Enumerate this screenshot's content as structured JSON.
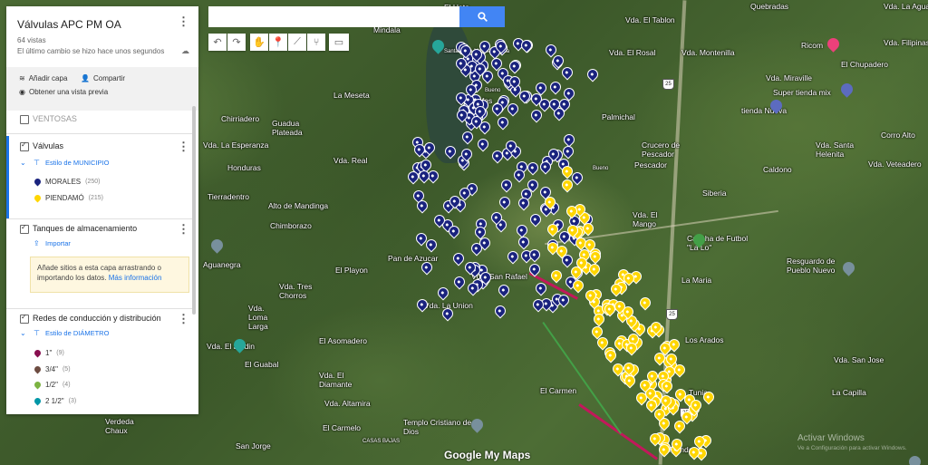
{
  "search": {
    "placeholder": "",
    "value": ""
  },
  "toolbar": {
    "undo_icon": "undo-icon",
    "redo_icon": "redo-icon",
    "hand_icon": "hand-icon",
    "marker_icon": "add-marker-icon",
    "line_icon": "draw-line-icon",
    "directions_icon": "directions-icon",
    "measure_icon": "ruler-icon"
  },
  "panel": {
    "title": "Válvulas APC PM OA",
    "views": "64 vistas",
    "last_change": "El último cambio se hizo hace unos segundos",
    "add_layer": "Añadir capa",
    "share": "Compartir",
    "preview": "Obtener una vista previa"
  },
  "layers": {
    "ventosas": {
      "name": "VENTOSAS"
    },
    "valvulas": {
      "name": "Válvulas",
      "style": "Estilo de MUNICIPIO",
      "items": [
        {
          "label": "MORALES",
          "count": "(250)",
          "color": "#1a237e"
        },
        {
          "label": "PIENDAMÓ",
          "count": "(215)",
          "color": "#ffd600"
        }
      ]
    },
    "tanques": {
      "name": "Tanques de almacenamiento",
      "import": "Importar",
      "notice": "Añade sitios a esta capa arrastrando o importando los datos.",
      "more_info": "Más información"
    },
    "redes": {
      "name": "Redes de conducción y distribución",
      "style": "Estilo de DIÁMETRO",
      "items": [
        {
          "label": "1\"",
          "count": "(9)",
          "color": "#880e4f"
        },
        {
          "label": "3/4\"",
          "count": "(5)",
          "color": "#6d4c41"
        },
        {
          "label": "1/2\"",
          "count": "(4)",
          "color": "#7cb342"
        },
        {
          "label": "2 1/2\"",
          "count": "(3)",
          "color": "#0097a7"
        }
      ]
    }
  },
  "map": {
    "places": [
      "Quebradas",
      "Vda. La Aguada",
      "El Hato",
      "Mindala",
      "Santa Rosa Morales cauca",
      "Vda. El Tablon",
      "Vda. El Rosal",
      "Vda. Montenilla",
      "Ricom",
      "Vda. Filipinas",
      "El Chupadero",
      "La Meseta",
      "Bueno",
      "Los Cafes",
      "Vda. Miraville",
      "Super tienda mix",
      "Chirriadero",
      "Guadua Plateada",
      "Palmichal",
      "Crucero de Pescador",
      "tienda Nueva",
      "Corro Alto",
      "Vda. La Esperanza",
      "Vda. Real",
      "Honduras",
      "Pescador",
      "Caldono",
      "Vda. Santa Helenita",
      "Vda. Veteadero",
      "Bueno",
      "Tierradentro",
      "Siberia",
      "Alto de Mandinga",
      "Chimborazo",
      "Vda. El Mango",
      "Cancha de Futbol \"La Lo\"",
      "Resguardo de Pueblo Nuevo",
      "Aguanegra",
      "El Playon",
      "Pan de Azucar",
      "Vda. San Rafael",
      "La Maria",
      "Vda. Tres Chorros",
      "Vda. Loma Larga",
      "Vda. La Union",
      "Los Arados",
      "Vda. El Jardin",
      "Vda. San Jose",
      "El Guabal",
      "El Asomadero",
      "Vda. El Diamante",
      "Vda. Altamira",
      "El Carmelo",
      "El Carmen",
      "Tunia",
      "La Capilla",
      "Verdeda Chaux",
      "Templo Cristiano de Dios",
      "Piendamó",
      "San Jorge",
      "CASAS BAJAS"
    ],
    "attribution": "Google My Maps"
  },
  "os": {
    "watermark": "Activar Windows",
    "watermark_sub": "Ve a Configuración para activar Windows."
  },
  "chart_data": null
}
